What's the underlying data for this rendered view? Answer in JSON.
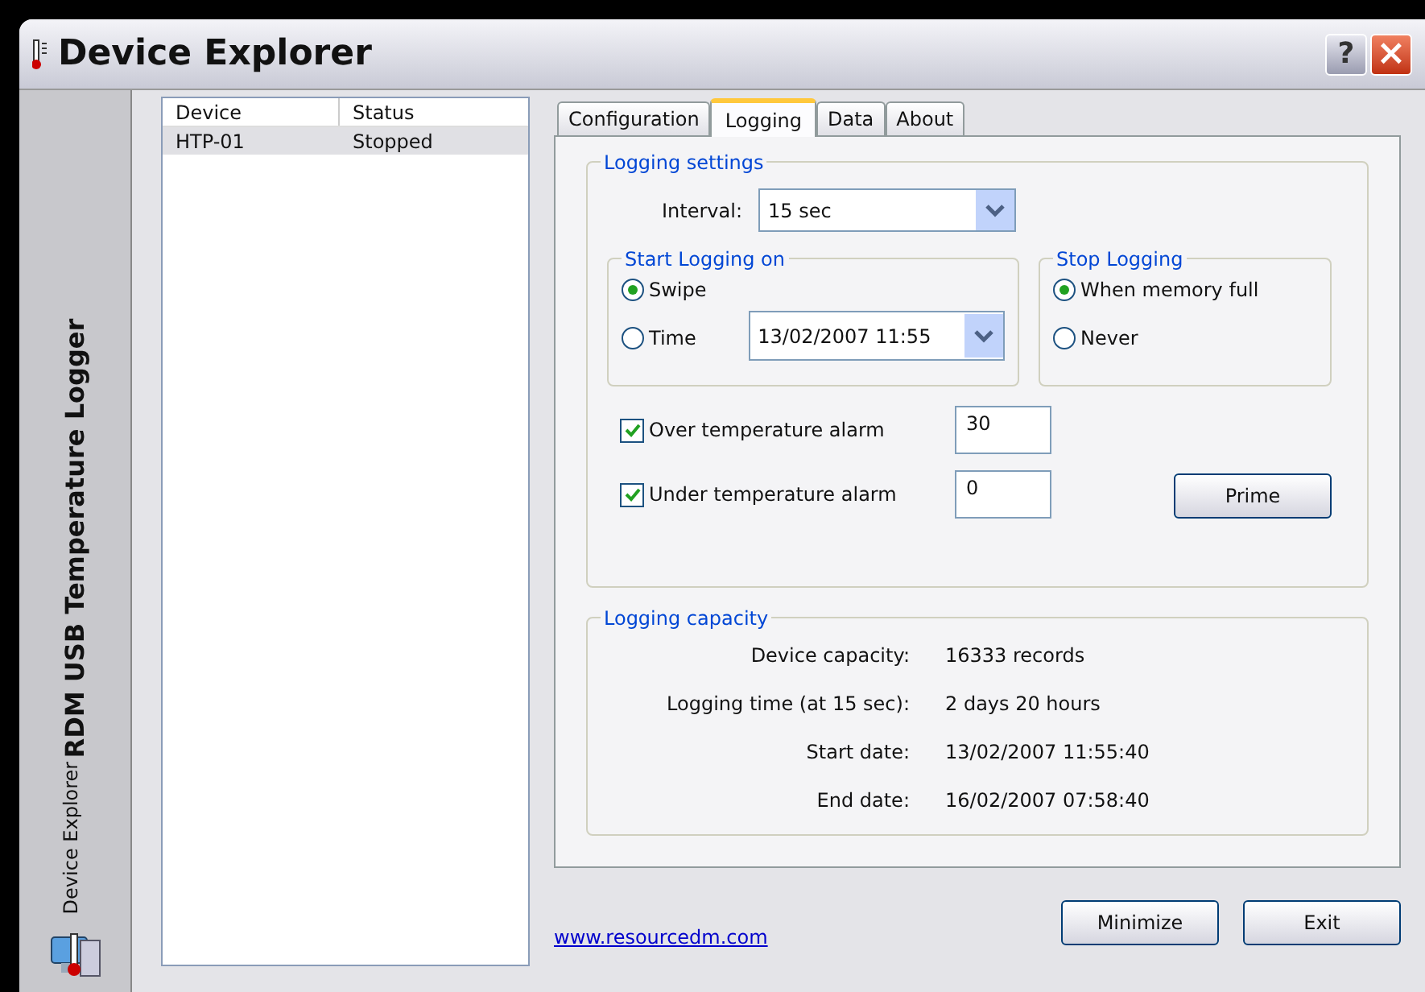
{
  "window": {
    "title": "Device Explorer",
    "help": "?",
    "close": "×"
  },
  "sidebar": {
    "product": "RDM USB Temperature Logger",
    "subtitle": "Device Explorer"
  },
  "device_list": {
    "columns": [
      "Device",
      "Status"
    ],
    "rows": [
      {
        "cells": [
          "HTP-01",
          "Stopped"
        ],
        "selected": true
      }
    ]
  },
  "tabs": [
    {
      "label": "Configuration",
      "selected": false
    },
    {
      "label": "Logging",
      "selected": true
    },
    {
      "label": "Data",
      "selected": false
    },
    {
      "label": "About",
      "selected": false
    }
  ],
  "logging_settings": {
    "title": "Logging settings",
    "interval_label": "Interval:",
    "interval_value": "15 sec",
    "start": {
      "title": "Start Logging on",
      "options": [
        {
          "label": "Swipe",
          "selected": true
        },
        {
          "label": "Time",
          "selected": false
        }
      ],
      "time_value": "13/02/2007 11:55"
    },
    "stop": {
      "title": "Stop Logging",
      "options": [
        {
          "label": "When memory full",
          "selected": true
        },
        {
          "label": "Never",
          "selected": false
        }
      ]
    },
    "alarms": [
      {
        "label": "Over temperature alarm",
        "checked": true,
        "value": "30"
      },
      {
        "label": "Under temperature alarm",
        "checked": true,
        "value": "0"
      }
    ],
    "prime_button": "Prime"
  },
  "logging_capacity": {
    "title": "Logging capacity",
    "rows": [
      {
        "label": "Device capacity:",
        "value": "16333 records"
      },
      {
        "label": "Logging time (at 15 sec):",
        "value": "2 days 20 hours"
      },
      {
        "label": "Start date:",
        "value": "13/02/2007 11:55:40"
      },
      {
        "label": "End date:",
        "value": "16/02/2007 07:58:40"
      }
    ]
  },
  "link": "www.resourcedm.com",
  "buttons": [
    "Minimize",
    "Exit"
  ]
}
